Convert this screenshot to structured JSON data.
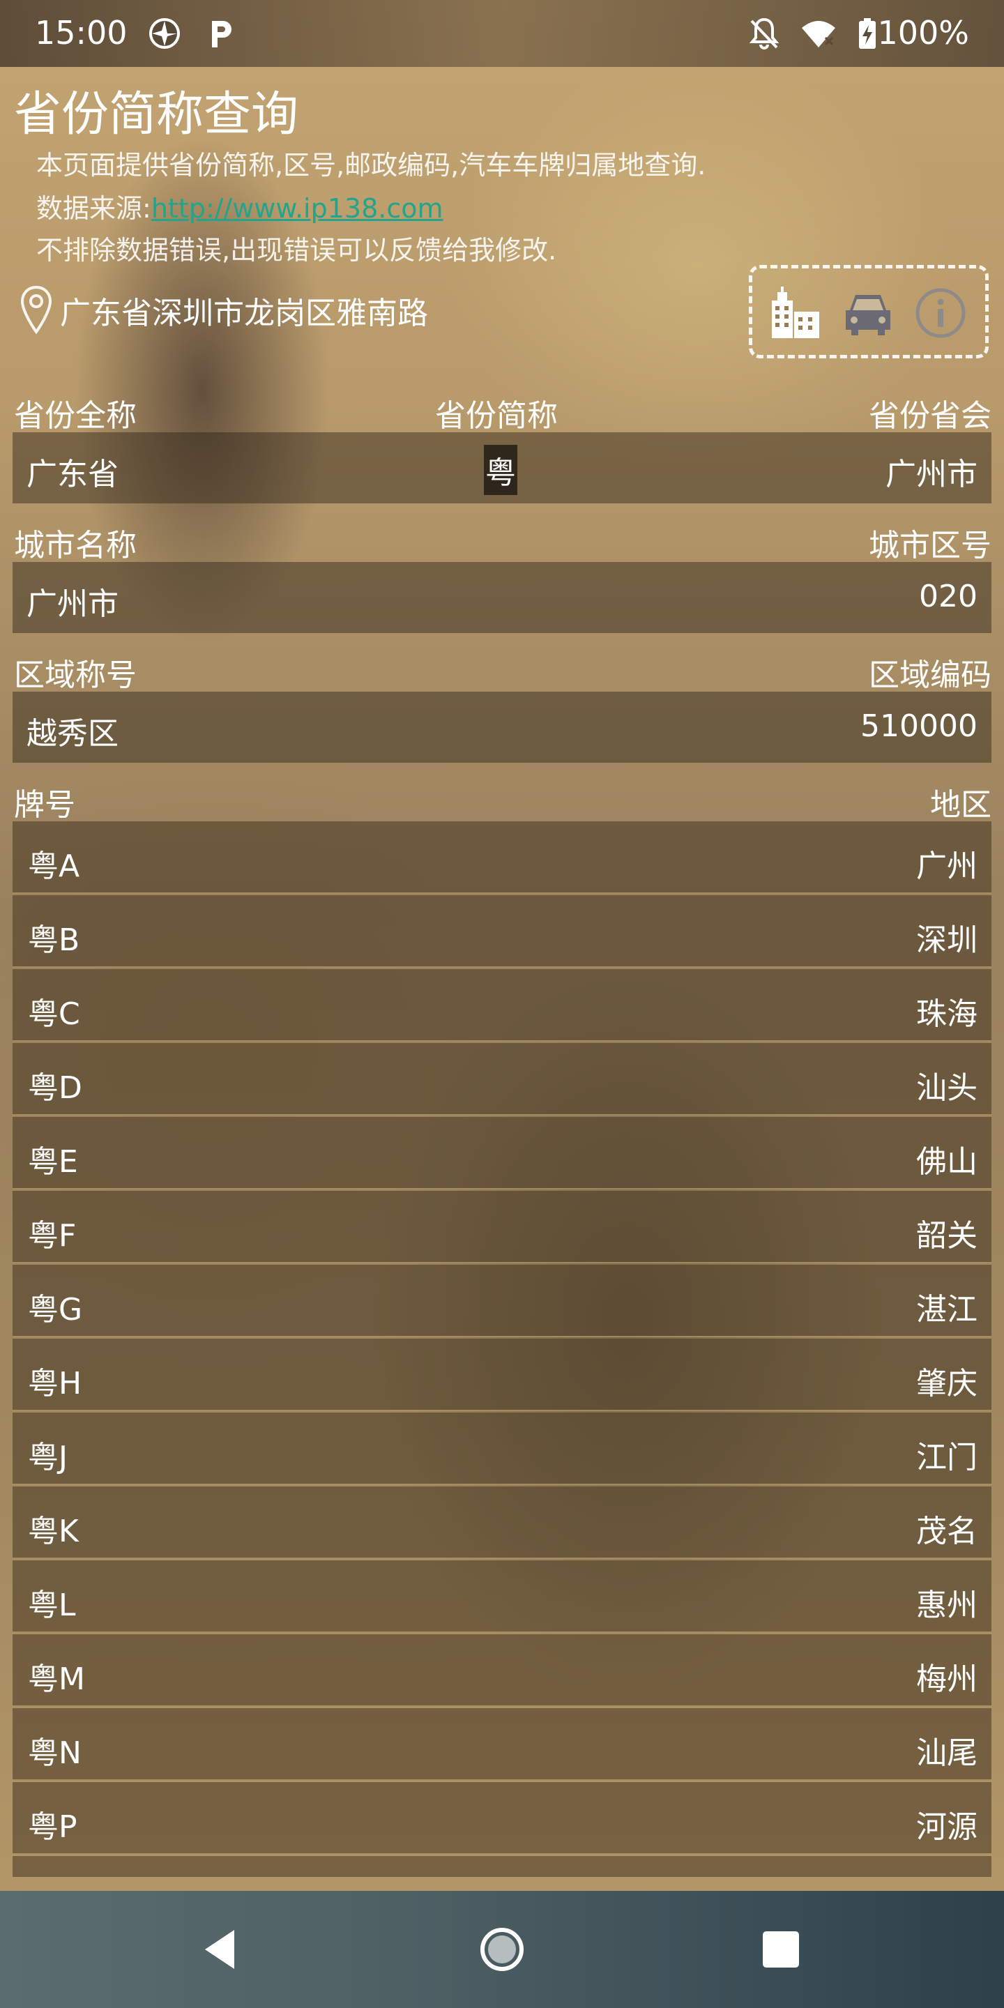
{
  "status_bar": {
    "time": "15:00",
    "battery": "100%",
    "icons": [
      "app-shutter-icon",
      "parking-p-icon",
      "bell-off-icon",
      "wifi-icon",
      "battery-charging-icon"
    ]
  },
  "header": {
    "title": "省份简称查询",
    "line1": "本页面提供省份简称,区号,邮政编码,汽车车牌归属地查询.",
    "line2_prefix": "数据来源:",
    "line2_link": "http://www.ip138.com",
    "line3": "不排除数据错误,出现错误可以反馈给我修改."
  },
  "location": {
    "text": "广东省深圳市龙岗区雅南路"
  },
  "tools": [
    "city-buildings-icon",
    "car-icon",
    "info-icon"
  ],
  "province": {
    "label_full": "省份全称",
    "label_short": "省份简称",
    "label_capital": "省份省会",
    "full": "广东省",
    "short": "粤",
    "capital": "广州市"
  },
  "city": {
    "label_name": "城市名称",
    "label_code": "城市区号",
    "name": "广州市",
    "code": "020"
  },
  "district": {
    "label_name": "区域称号",
    "label_code": "区域编码",
    "name": "越秀区",
    "code": "510000"
  },
  "plates": {
    "label_plate": "牌号",
    "label_region": "地区",
    "rows": [
      {
        "plate": "粤A",
        "region": "广州"
      },
      {
        "plate": "粤B",
        "region": "深圳"
      },
      {
        "plate": "粤C",
        "region": "珠海"
      },
      {
        "plate": "粤D",
        "region": "汕头"
      },
      {
        "plate": "粤E",
        "region": "佛山"
      },
      {
        "plate": "粤F",
        "region": "韶关"
      },
      {
        "plate": "粤G",
        "region": "湛江"
      },
      {
        "plate": "粤H",
        "region": "肇庆"
      },
      {
        "plate": "粤J",
        "region": "江门"
      },
      {
        "plate": "粤K",
        "region": "茂名"
      },
      {
        "plate": "粤L",
        "region": "惠州"
      },
      {
        "plate": "粤M",
        "region": "梅州"
      },
      {
        "plate": "粤N",
        "region": "汕尾"
      },
      {
        "plate": "粤P",
        "region": "河源"
      }
    ]
  },
  "nav": [
    "back-icon",
    "home-icon",
    "recents-icon"
  ]
}
